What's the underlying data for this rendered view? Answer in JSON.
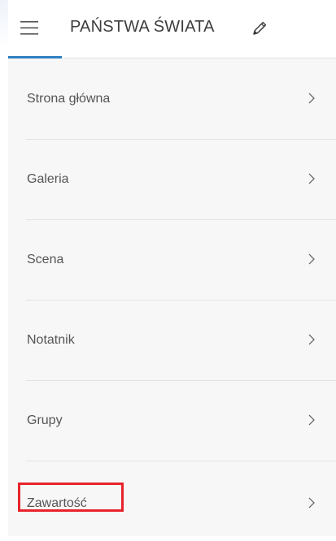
{
  "header": {
    "title": "PAŃSTWA ŚWIATA",
    "menu_icon": "hamburger-menu-icon",
    "edit_icon": "pencil-icon",
    "accent_color": "#2f7fc1"
  },
  "menu": {
    "items": [
      {
        "label": "Strona główna",
        "icon": "chevron-right-icon"
      },
      {
        "label": "Galeria",
        "icon": "chevron-right-icon"
      },
      {
        "label": "Scena",
        "icon": "chevron-right-icon"
      },
      {
        "label": "Notatnik",
        "icon": "chevron-right-icon"
      },
      {
        "label": "Grupy",
        "icon": "chevron-right-icon"
      },
      {
        "label": "Zawartość",
        "icon": "chevron-right-icon",
        "highlighted": true,
        "highlight_color": "#e8232c"
      }
    ]
  }
}
